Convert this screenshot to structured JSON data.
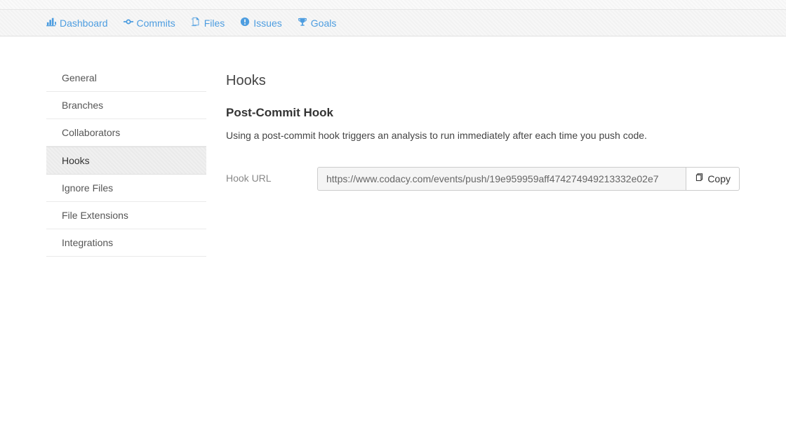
{
  "nav": {
    "items": [
      {
        "label": "Dashboard",
        "icon": "bar-chart"
      },
      {
        "label": "Commits",
        "icon": "commit"
      },
      {
        "label": "Files",
        "icon": "files"
      },
      {
        "label": "Issues",
        "icon": "alert"
      },
      {
        "label": "Goals",
        "icon": "trophy"
      }
    ]
  },
  "sidebar": {
    "items": [
      {
        "label": "General"
      },
      {
        "label": "Branches"
      },
      {
        "label": "Collaborators"
      },
      {
        "label": "Hooks",
        "active": true
      },
      {
        "label": "Ignore Files"
      },
      {
        "label": "File Extensions"
      },
      {
        "label": "Integrations"
      }
    ]
  },
  "main": {
    "page_title": "Hooks",
    "section_title": "Post-Commit Hook",
    "description": "Using a post-commit hook triggers an analysis to run immediately after each time you push code.",
    "hook_url_label": "Hook URL",
    "hook_url_value": "https://www.codacy.com/events/push/19e959959aff474274949213332e02e7",
    "copy_label": "Copy"
  }
}
